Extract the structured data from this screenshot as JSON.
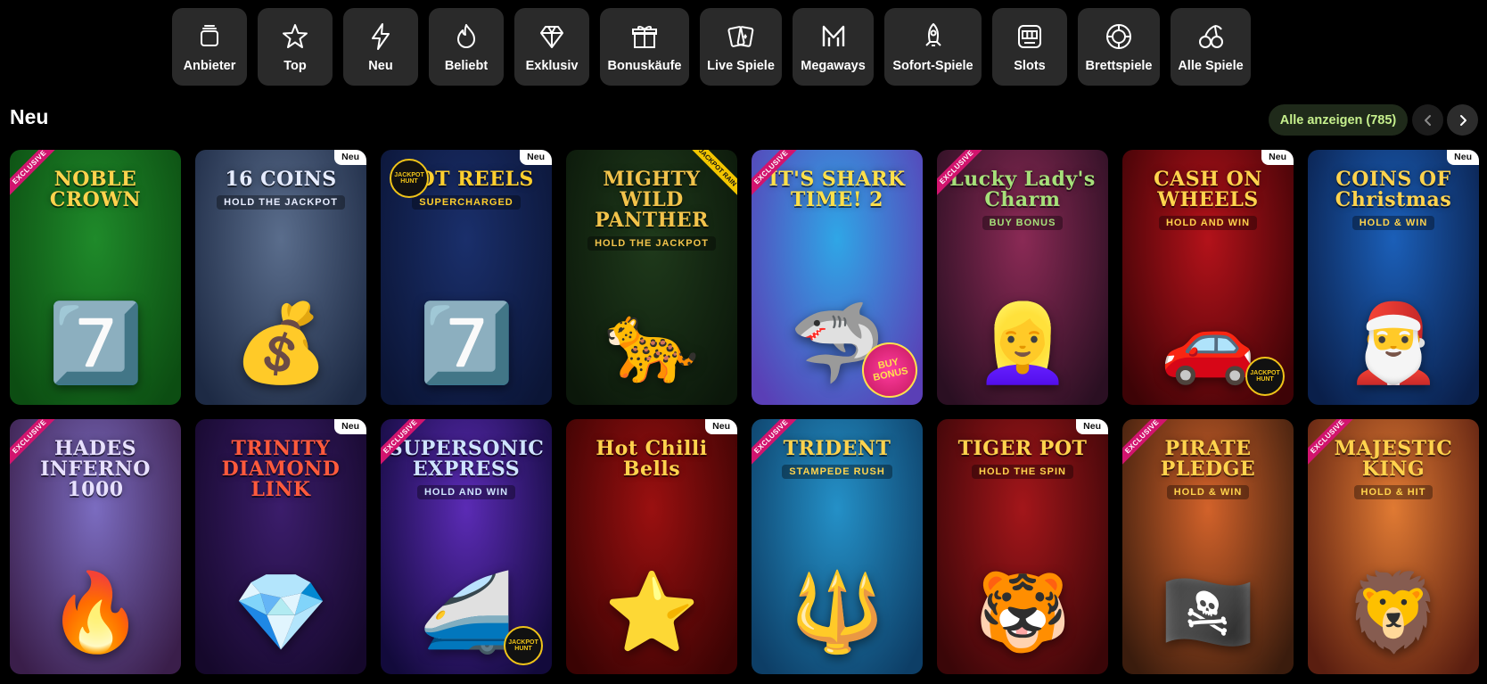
{
  "categories": [
    {
      "label": "Anbieter",
      "icon": "cards-stack-icon"
    },
    {
      "label": "Top",
      "icon": "star-icon"
    },
    {
      "label": "Neu",
      "icon": "lightning-icon"
    },
    {
      "label": "Beliebt",
      "icon": "flame-icon"
    },
    {
      "label": "Exklusiv",
      "icon": "diamond-icon"
    },
    {
      "label": "Bonuskäufe",
      "icon": "gift-icon"
    },
    {
      "label": "Live Spiele",
      "icon": "playing-cards-icon"
    },
    {
      "label": "Megaways",
      "icon": "megaways-m-icon"
    },
    {
      "label": "Sofort-Spiele",
      "icon": "rocket-icon"
    },
    {
      "label": "Slots",
      "icon": "slot-machine-icon"
    },
    {
      "label": "Brettspiele",
      "icon": "roulette-chip-icon"
    },
    {
      "label": "Alle Spiele",
      "icon": "cherries-icon"
    }
  ],
  "section": {
    "title": "Neu",
    "show_all": "Alle anzeigen (785)"
  },
  "badges": {
    "new": "Neu",
    "exclusive": "EXCLUSIVE",
    "jackpot_rain": "JACKPOT RAIN",
    "jackpot_hunt": "JACKPOT HUNT",
    "buy_bonus": "BUY BONUS"
  },
  "games": [
    {
      "title": "NOBLE CROWN",
      "subtitle": "",
      "exclusive": true,
      "new": false,
      "bg": "#1f8a2a",
      "bg2": "#0c4d12",
      "color": "#ffd34d",
      "art": "7️⃣"
    },
    {
      "title": "16 COINS",
      "subtitle": "HOLD THE JACKPOT",
      "exclusive": false,
      "new": true,
      "bg": "#5a6d8c",
      "bg2": "#1d2a44",
      "color": "#e6ecff",
      "art": "💰"
    },
    {
      "title": "HOT REELS",
      "subtitle": "SUPERCHARGED",
      "exclusive": false,
      "new": true,
      "jackpot_hunt": "tl",
      "bg": "#1a2f6b",
      "bg2": "#0b1536",
      "color": "#ffcf2e",
      "art": "7️⃣"
    },
    {
      "title": "MIGHTY WILD PANTHER",
      "subtitle": "HOLD THE JACKPOT",
      "exclusive": false,
      "new": false,
      "jackpot_rain": true,
      "bg": "#1f3a1b",
      "bg2": "#0b170a",
      "color": "#f2c34b",
      "art": "🐆"
    },
    {
      "title": "IT'S SHARK TIME! 2",
      "subtitle": "",
      "exclusive": true,
      "new": false,
      "buy_bonus": true,
      "bg": "#2fa6e6",
      "bg2": "#5a3fb6",
      "color": "#ffe04a",
      "art": "🦈"
    },
    {
      "title": "Lucky Lady's Charm",
      "subtitle": "BUY BONUS",
      "exclusive": true,
      "new": false,
      "bg": "#8a2a55",
      "bg2": "#2a0f22",
      "color": "#a6e07a",
      "art": "👱‍♀️"
    },
    {
      "title": "CASH ON WHEELS",
      "subtitle": "HOLD AND WIN",
      "exclusive": false,
      "new": true,
      "jackpot_hunt": "br",
      "bg": "#b3121a",
      "bg2": "#3d0306",
      "color": "#ffd34d",
      "art": "🚗"
    },
    {
      "title": "COINS OF Christmas",
      "subtitle": "HOLD & WIN",
      "exclusive": false,
      "new": true,
      "bg": "#1b5fb8",
      "bg2": "#0a1f4a",
      "color": "#ffd34d",
      "art": "🎅"
    },
    {
      "title": "HADES INFERNO 1000",
      "subtitle": "",
      "exclusive": true,
      "new": false,
      "bg": "#7b6cc0",
      "bg2": "#3a1e4a",
      "color": "#e8e1ff",
      "art": "🔥"
    },
    {
      "title": "TRINITY DIAMOND LINK",
      "subtitle": "",
      "exclusive": false,
      "new": true,
      "bg": "#3b1d6b",
      "bg2": "#15082b",
      "color": "#ff5a3c",
      "art": "💎"
    },
    {
      "title": "SUPERSONIC EXPRESS",
      "subtitle": "HOLD AND WIN",
      "exclusive": true,
      "new": false,
      "jackpot_hunt": "br",
      "bg": "#5b2bb5",
      "bg2": "#120a3b",
      "color": "#cfe4ff",
      "art": "🚄"
    },
    {
      "title": "Hot Chilli Bells",
      "subtitle": "",
      "exclusive": false,
      "new": true,
      "bg": "#9a1010",
      "bg2": "#3a0303",
      "color": "#ffd34d",
      "art": "⭐"
    },
    {
      "title": "TRIDENT",
      "subtitle": "STAMPEDE RUSH",
      "exclusive": true,
      "new": false,
      "bg": "#2490c7",
      "bg2": "#0d3e66",
      "color": "#ffd34d",
      "art": "🔱"
    },
    {
      "title": "TIGER POT",
      "subtitle": "HOLD THE SPIN",
      "exclusive": false,
      "new": true,
      "bg": "#a3161a",
      "bg2": "#3a0608",
      "color": "#ffd34d",
      "art": "🐯"
    },
    {
      "title": "PIRATE PLEDGE",
      "subtitle": "HOLD & WIN",
      "exclusive": true,
      "new": false,
      "bg": "#d2622a",
      "bg2": "#3a1c0d",
      "color": "#ffd34d",
      "art": "🏴‍☠️"
    },
    {
      "title": "MAJESTIC KING",
      "subtitle": "HOLD & HIT",
      "exclusive": true,
      "new": false,
      "bg": "#e07a33",
      "bg2": "#5a1e10",
      "color": "#ffd34d",
      "art": "🦁"
    }
  ],
  "colors": {
    "background": "#000000",
    "category_bg": "#2a2a2a",
    "show_all_text": "#c6f08d",
    "exclusive_ribbon": "#d2146e"
  }
}
